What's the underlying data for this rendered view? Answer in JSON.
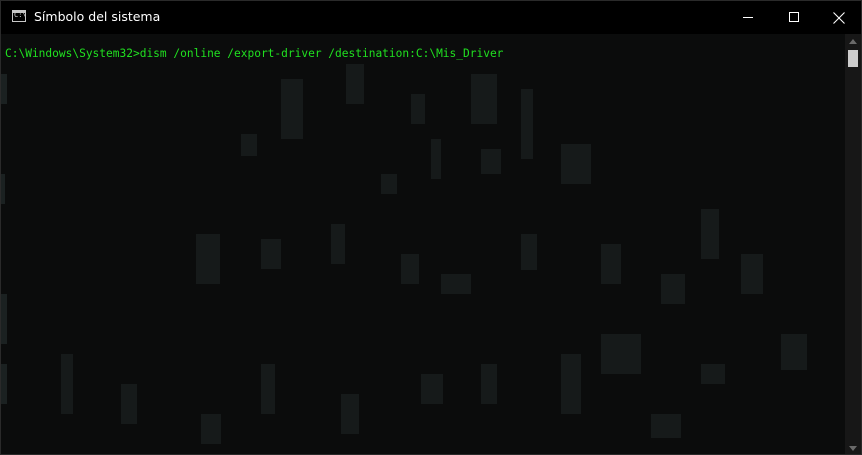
{
  "window": {
    "title": "Símbolo del sistema",
    "icon": "cmd-icon",
    "icon_text": "C:\\."
  },
  "caption_buttons": {
    "minimize": "minimize-icon",
    "maximize": "maximize-icon",
    "close": "close-icon"
  },
  "console": {
    "lines": [
      "C:\\Windows\\System32>dism /online /export-driver /destination:C:\\Mis_Driver"
    ]
  },
  "colors": {
    "titlebar_bg": "#000000",
    "console_bg": "#0c0c0c",
    "console_text": "#20e020",
    "scrollbar_bg": "#171717",
    "scroll_thumb": "#cdcdcd"
  }
}
